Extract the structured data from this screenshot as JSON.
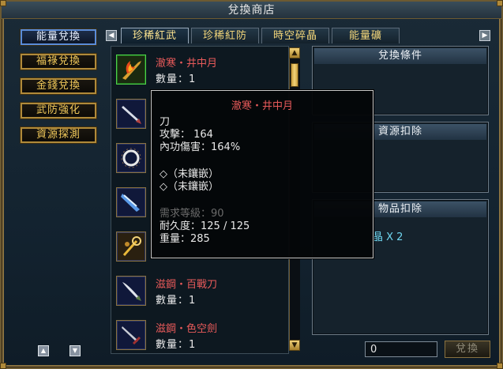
{
  "window": {
    "title": "兌換商店"
  },
  "nav": [
    {
      "label": "能量兌換",
      "active": true
    },
    {
      "label": "福祿兌換",
      "active": false
    },
    {
      "label": "金錢兌換",
      "active": false
    },
    {
      "label": "武防強化",
      "active": false
    },
    {
      "label": "資源探測",
      "active": false
    }
  ],
  "tabs": [
    {
      "label": "珍稀紅武",
      "active": true
    },
    {
      "label": "珍稀紅防",
      "active": false
    },
    {
      "label": "時空碎晶",
      "active": false
    },
    {
      "label": "能量礦",
      "active": false
    }
  ],
  "items": [
    {
      "name": "澈寒・井中月",
      "qty": "數量：1",
      "icon": "flame-blade-icon",
      "selected": true
    },
    {
      "name": "",
      "qty": "",
      "icon": "sword-icon",
      "selected": false
    },
    {
      "name": "",
      "qty": "",
      "icon": "spiked-ring-icon",
      "selected": false
    },
    {
      "name": "",
      "qty": "",
      "icon": "ice-blade-icon",
      "selected": false
    },
    {
      "name": "",
      "qty": "",
      "icon": "golden-staff-icon",
      "selected": false
    },
    {
      "name": "滋鋼・百戰刀",
      "qty": "數量：1",
      "icon": "broadsword-icon",
      "selected": false
    },
    {
      "name": "滋鋼・色空劍",
      "qty": "數量：1",
      "icon": "longsword-icon",
      "selected": false
    }
  ],
  "panels": {
    "exchange_conditions": {
      "title": "兌換條件"
    },
    "resource_deduction": {
      "title": "資源扣除"
    },
    "item_deduction": {
      "title": "物品扣除",
      "value": "晶 X 2"
    }
  },
  "quantity": {
    "value": "0"
  },
  "confirm_button": {
    "label": "兌換"
  },
  "tooltip": {
    "title": "澈寒・井中月",
    "type": "刀",
    "attack": "攻擊： 164",
    "inner_damage": "內功傷害：164%",
    "socket1": "◇（未鑲嵌）",
    "socket2": "◇（未鑲嵌）",
    "req_level": "需求等級：90",
    "durability": "耐久度：125 / 125",
    "weight": "重量：285"
  },
  "colors": {
    "item_name": "#e85a5a",
    "nav_text": "#f0c85a",
    "tab_text": "#f4d77a",
    "cyan_text": "#6fd6f0"
  }
}
